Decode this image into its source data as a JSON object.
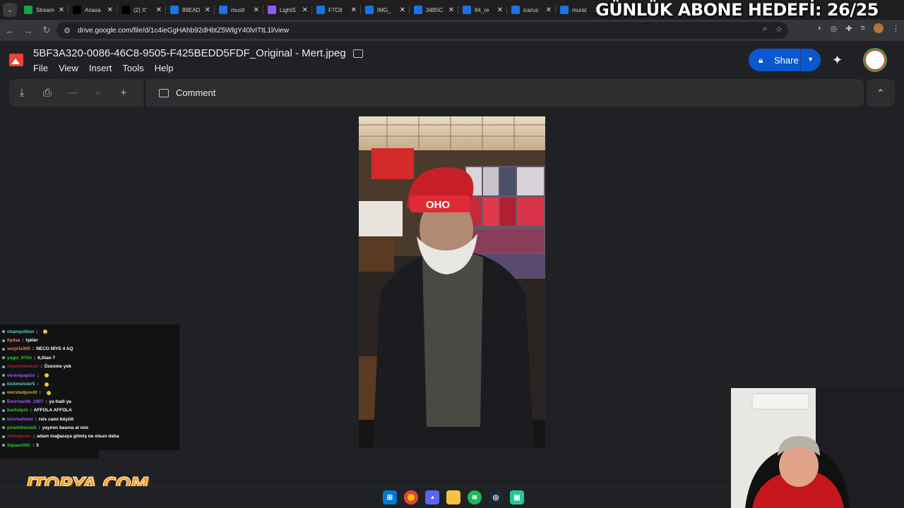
{
  "browser": {
    "tabs": [
      {
        "title": "Stream",
        "icon": "twitch-icon",
        "color": "#16a34a"
      },
      {
        "title": "Anasa",
        "icon": "x-logo-icon",
        "color": "#000000"
      },
      {
        "title": "(2) X'",
        "icon": "x-logo-icon",
        "color": "#000000"
      },
      {
        "title": "89EAD",
        "icon": "google-drive-icon",
        "color": "#1a73e8"
      },
      {
        "title": "mustl",
        "icon": "google-drive-icon",
        "color": "#1a73e8"
      },
      {
        "title": "LightS",
        "icon": "pen-icon",
        "color": "#8b5cf6"
      },
      {
        "title": "F7C8",
        "icon": "google-drive-icon",
        "color": "#1a73e8"
      },
      {
        "title": "IMG_",
        "icon": "google-drive-icon",
        "color": "#1a73e8"
      },
      {
        "title": "34B5C",
        "icon": "google-drive-icon",
        "color": "#1a73e8"
      },
      {
        "title": "84_re",
        "icon": "google-drive-icon",
        "color": "#1a73e8"
      },
      {
        "title": "icarus",
        "icon": "google-drive-icon",
        "color": "#1a73e8"
      },
      {
        "title": "murat",
        "icon": "google-drive-icon",
        "color": "#1a73e8"
      }
    ],
    "url": "drive.google.com/file/d/1c4ieGgHAhb92dHbtZ5WlgY40lvITtL1l/view"
  },
  "overlay": {
    "goal_text": "GÜNLÜK ABONE HEDEFİ: 26/25",
    "logo_text": "ITOPYA.COM"
  },
  "viewer": {
    "filename": "5BF3A320-0086-46C8-9505-F425BEDD5FDF_Original - Mert.jpeg",
    "menus": [
      "File",
      "View",
      "Insert",
      "Tools",
      "Help"
    ],
    "share_label": "Share",
    "comment_label": "Comment",
    "colors": {
      "share": "#0b57d0",
      "app_icon": "#ea4335"
    }
  },
  "chat": [
    {
      "user": "champollion",
      "user_color": "#52d4c7",
      "msg": ""
    },
    {
      "user": "liydaa",
      "user_color": "#ff7f50",
      "msg": "tşkler"
    },
    {
      "user": "surpris300",
      "user_color": "#ff7f50",
      "msg": "NECO NİYE 4 AQ"
    },
    {
      "user": "yagiz_97hh",
      "user_color": "#32cd32",
      "msg": "6,Stan 7"
    },
    {
      "user": "disunloberkan",
      "user_color": "#b22222",
      "msg": "Özenme yok"
    },
    {
      "user": "ekrempapizo",
      "user_color": "#9b59ff",
      "msg": ""
    },
    {
      "user": "kickmeister5",
      "user_color": "#52d4c7",
      "msg": ""
    },
    {
      "user": "worstedpostit",
      "user_color": "#daa520",
      "msg": ""
    },
    {
      "user": "Emirhan06_1907",
      "user_color": "#9b59ff",
      "msg": "ya hadi ya"
    },
    {
      "user": "barlistprk",
      "user_color": "#32cd32",
      "msg": "AFFOLA AFFOLA"
    },
    {
      "user": "kirichahmet",
      "user_color": "#9b59ff",
      "msg": "reis cami büyült"
    },
    {
      "user": "piramitiscisi5",
      "user_color": "#32cd32",
      "msg": "yayının basına al reis"
    },
    {
      "user": "rentrepuen",
      "user_color": "#b22222",
      "msg": "adam mağazaya gitmiş ne olsun daha"
    },
    {
      "user": "SquareXtC",
      "user_color": "#32cd32",
      "msg": "5"
    }
  ]
}
